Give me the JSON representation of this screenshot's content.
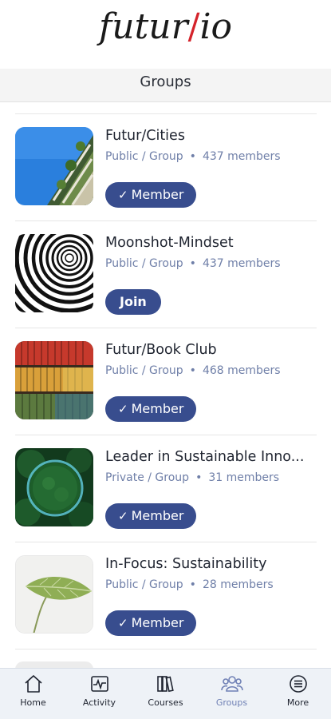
{
  "app": {
    "logo_left": "futur",
    "logo_slash": "/",
    "logo_right": "io"
  },
  "header": {
    "title": "Groups"
  },
  "groups": [
    {
      "name": "Futur/Cities",
      "visibility": "Public / Group",
      "members": "437 members",
      "button": "Member",
      "status": "member"
    },
    {
      "name": "Moonshot-Mindset",
      "visibility": "Public / Group",
      "members": "437 members",
      "button": "Join",
      "status": "join"
    },
    {
      "name": "Futur/Book Club",
      "visibility": "Public / Group",
      "members": "468 members",
      "button": "Member",
      "status": "member"
    },
    {
      "name": "Leader in Sustainable Inno...",
      "visibility": "Private / Group",
      "members": "31 members",
      "button": "Member",
      "status": "member"
    },
    {
      "name": "In-Focus: Sustainability",
      "visibility": "Public / Group",
      "members": "28 members",
      "button": "Member",
      "status": "member"
    }
  ],
  "tabbar": {
    "items": [
      {
        "label": "Home",
        "icon": "home-icon"
      },
      {
        "label": "Activity",
        "icon": "activity-icon"
      },
      {
        "label": "Courses",
        "icon": "courses-icon"
      },
      {
        "label": "Groups",
        "icon": "groups-icon",
        "active": true
      },
      {
        "label": "More",
        "icon": "more-icon"
      }
    ]
  },
  "colors": {
    "accent": "#384d8e",
    "meta_text": "#6f7fa8",
    "logo_slash": "#d4232b",
    "active_tab": "#6f80b5"
  }
}
